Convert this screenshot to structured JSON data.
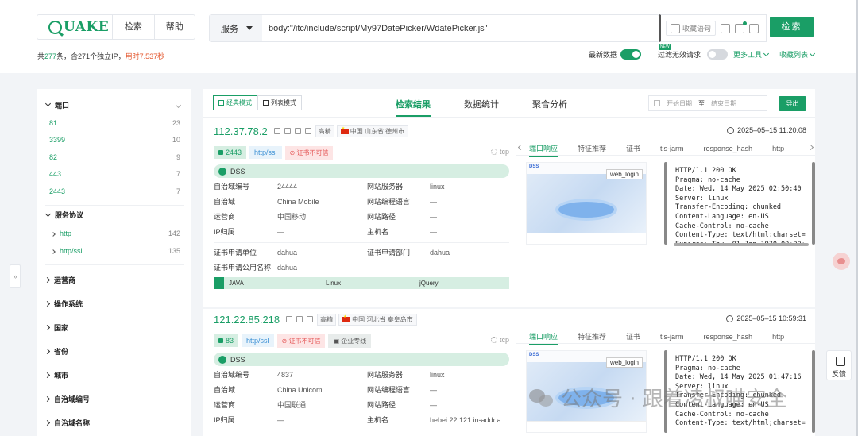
{
  "header": {
    "logo_text": "QUAKE",
    "nav": [
      "检索",
      "帮助"
    ],
    "service_select": "服务",
    "query": "body:\"/itc/include/script/My97DatePicker/WdatePicker.js\"",
    "fav_label": "收藏语句",
    "search_button": "检索"
  },
  "stats": {
    "prefix": "共",
    "total": "277",
    "middle": "条，含271个独立IP，",
    "time": "用时7.537秒"
  },
  "toggles": {
    "latest": "最新数据",
    "filter_invalid": "过滤无效请求",
    "new_badge": "NEW",
    "more_tools": "更多工具",
    "favorites": "收藏列表"
  },
  "sidebar": {
    "port_title": "端口",
    "ports": [
      {
        "port": "81",
        "count": "23"
      },
      {
        "port": "3399",
        "count": "10"
      },
      {
        "port": "82",
        "count": "9"
      },
      {
        "port": "443",
        "count": "7"
      },
      {
        "port": "2443",
        "count": "7"
      }
    ],
    "protocol_title": "服务协议",
    "protocols": [
      {
        "name": "http",
        "count": "142"
      },
      {
        "name": "http/ssl",
        "count": "135"
      }
    ],
    "sections": [
      "运营商",
      "操作系统",
      "国家",
      "省份",
      "城市",
      "自治域编号",
      "自治域名称"
    ],
    "collapse": "»"
  },
  "results": {
    "mode_classic": "经典模式",
    "mode_list": "列表模式",
    "tabs": [
      "检索结果",
      "数据统计",
      "聚合分析"
    ],
    "start_date": "开始日期",
    "to": "至",
    "end_date": "结束日期",
    "export": "导出"
  },
  "cards": [
    {
      "ip": "112.37.78.2",
      "quality": "高精",
      "location": "中国 山东省 德州市",
      "time": "2025–05–15 11:20:08",
      "port": "2443",
      "proto": "http/ssl",
      "cert": "证书不可信",
      "transport": "tcp",
      "product": "DSS",
      "kv": [
        [
          "自治域编号",
          "24444",
          "网站服务器",
          "linux"
        ],
        [
          "自治域",
          "China Mobile",
          "网站编程语言",
          "—"
        ],
        [
          "运营商",
          "中国移动",
          "网站路径",
          "—"
        ],
        [
          "IP归属",
          "—",
          "主机名",
          "—"
        ]
      ],
      "cert_kv": [
        [
          "证书申请单位",
          "dahua",
          "证书申请部门",
          "dahua"
        ],
        [
          "证书申请公用名称",
          "dahua",
          "",
          ""
        ]
      ],
      "tech": [
        "JAVA",
        "Linux",
        "jQuery"
      ],
      "right_tabs": [
        "端口响应",
        "特征推荐",
        "证书",
        "tls-jarm",
        "response_hash",
        "http"
      ],
      "thumb_label": "web_login",
      "thumb_brand": "DSS",
      "response": "HTTP/1.1 200 OK\nPragma: no-cache\nDate: Wed, 14 May 2025 02:50:40\nServer: linux\nTransfer-Encoding: chunked\nContent-Language: en-US\nCache-Control: no-cache\nContent-Type: text/html;charset=\nExpires: Thu, 01 Jan 1970 00:00:"
    },
    {
      "ip": "121.22.85.218",
      "quality": "高精",
      "location": "中国 河北省 秦皇岛市",
      "time": "2025–05–15 10:59:31",
      "port": "83",
      "proto": "http/ssl",
      "cert": "证书不可信",
      "enterprise": "企业专线",
      "transport": "tcp",
      "product": "DSS",
      "kv": [
        [
          "自治域编号",
          "4837",
          "网站服务器",
          "linux"
        ],
        [
          "自治域",
          "China Unicom",
          "网站编程语言",
          "—"
        ],
        [
          "运营商",
          "中国联通",
          "网站路径",
          "—"
        ],
        [
          "IP归属",
          "—",
          "主机名",
          "hebei.22.121.in-addr.a..."
        ]
      ],
      "right_tabs": [
        "端口响应",
        "特征推荐",
        "证书",
        "tls-jarm",
        "response_hash",
        "http"
      ],
      "thumb_label": "web_login",
      "thumb_brand": "DSS",
      "response": "HTTP/1.1 200 OK\nPragma: no-cache\nDate: Wed, 14 May 2025 01:47:16\nServer: linux\nTransfer-Encoding: chunked\nContent-Language: en-US\nCache-Control: no-cache\nContent-Type: text/html;charset="
    }
  ],
  "floating": {
    "feedback": "反馈"
  },
  "watermark": "公众号 · 跟着凌叔喵安全",
  "colors": {
    "accent": "#1a9e66",
    "danger": "#e55b5b",
    "link_blue": "#3a8fd4"
  }
}
